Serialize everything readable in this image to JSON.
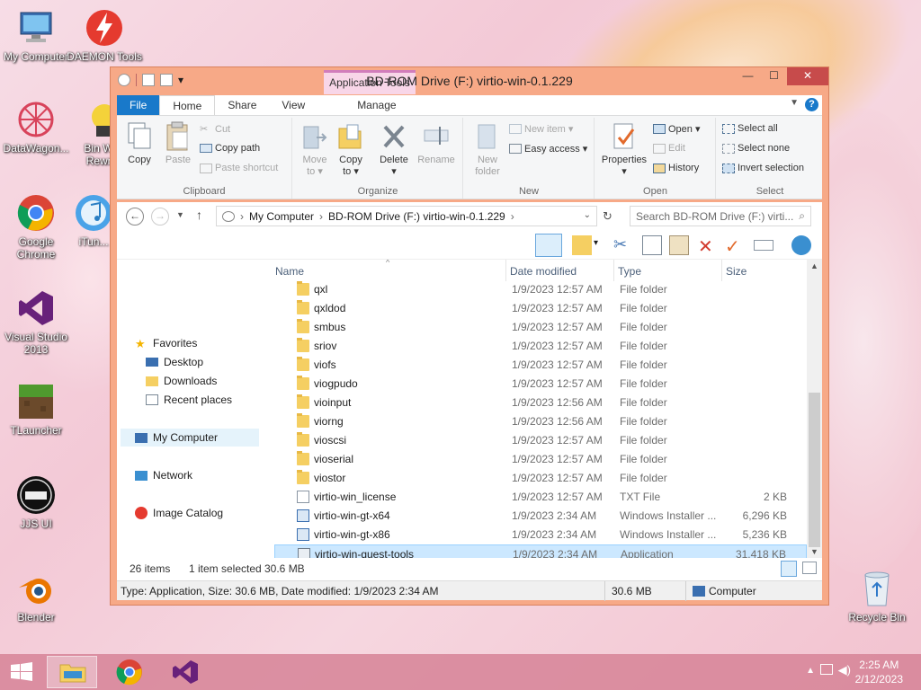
{
  "desktop": {
    "icons": [
      {
        "label": "My Computer"
      },
      {
        "label": "DAEMON Tools"
      },
      {
        "label": "DataWagon..."
      },
      {
        "label": "Bin Wea Rewri..."
      },
      {
        "label": "Google Chrome"
      },
      {
        "label": "iTun..."
      },
      {
        "label": "Visual Studio 2013"
      },
      {
        "label": "TLauncher"
      },
      {
        "label": "JJS UI"
      },
      {
        "label": "Blender"
      },
      {
        "label": "Recycle Bin"
      }
    ]
  },
  "window": {
    "title": "BD-ROM Drive (F:) virtio-win-0.1.229",
    "contextual_tab_group": "Application Tools",
    "controls": {
      "minimize": "—",
      "maximize": "☐",
      "close": "✕"
    }
  },
  "ribbon": {
    "tabs": [
      "File",
      "Home",
      "Share",
      "View",
      "Manage"
    ],
    "help": "?",
    "groups": {
      "clipboard": {
        "label": "Clipboard",
        "copy": "Copy",
        "paste": "Paste",
        "cut": "Cut",
        "copy_path": "Copy path",
        "paste_shortcut": "Paste shortcut"
      },
      "organize": {
        "label": "Organize",
        "move_to": "Move to ▾",
        "copy_to": "Copy to ▾",
        "delete": "Delete ▾",
        "rename": "Rename"
      },
      "new": {
        "label": "New",
        "new_folder": "New folder",
        "new_item": "New item ▾",
        "easy_access": "Easy access ▾"
      },
      "open": {
        "label": "Open",
        "properties": "Properties ▾",
        "open": "Open ▾",
        "edit": "Edit",
        "history": "History"
      },
      "select": {
        "label": "Select",
        "select_all": "Select all",
        "select_none": "Select none",
        "invert_selection": "Invert selection"
      }
    }
  },
  "address": {
    "crumbs": [
      "My Computer",
      "BD-ROM Drive (F:) virtio-win-0.1.229"
    ],
    "search_placeholder": "Search BD-ROM Drive (F:) virti..."
  },
  "nav": {
    "favorites": "Favorites",
    "desktop": "Desktop",
    "downloads": "Downloads",
    "recent": "Recent places",
    "my_computer": "My Computer",
    "network": "Network",
    "image_catalog": "Image Catalog"
  },
  "columns": {
    "name": "Name",
    "date": "Date modified",
    "type": "Type",
    "size": "Size"
  },
  "files": [
    {
      "name": "qxl",
      "date": "1/9/2023 12:57 AM",
      "type": "File folder",
      "size": "",
      "kind": "folder"
    },
    {
      "name": "qxldod",
      "date": "1/9/2023 12:57 AM",
      "type": "File folder",
      "size": "",
      "kind": "folder"
    },
    {
      "name": "smbus",
      "date": "1/9/2023 12:57 AM",
      "type": "File folder",
      "size": "",
      "kind": "folder"
    },
    {
      "name": "sriov",
      "date": "1/9/2023 12:57 AM",
      "type": "File folder",
      "size": "",
      "kind": "folder"
    },
    {
      "name": "viofs",
      "date": "1/9/2023 12:57 AM",
      "type": "File folder",
      "size": "",
      "kind": "folder"
    },
    {
      "name": "viogpudo",
      "date": "1/9/2023 12:57 AM",
      "type": "File folder",
      "size": "",
      "kind": "folder"
    },
    {
      "name": "vioinput",
      "date": "1/9/2023 12:56 AM",
      "type": "File folder",
      "size": "",
      "kind": "folder"
    },
    {
      "name": "viorng",
      "date": "1/9/2023 12:56 AM",
      "type": "File folder",
      "size": "",
      "kind": "folder"
    },
    {
      "name": "vioscsi",
      "date": "1/9/2023 12:57 AM",
      "type": "File folder",
      "size": "",
      "kind": "folder"
    },
    {
      "name": "vioserial",
      "date": "1/9/2023 12:57 AM",
      "type": "File folder",
      "size": "",
      "kind": "folder"
    },
    {
      "name": "viostor",
      "date": "1/9/2023 12:57 AM",
      "type": "File folder",
      "size": "",
      "kind": "folder"
    },
    {
      "name": "virtio-win_license",
      "date": "1/9/2023 12:57 AM",
      "type": "TXT File",
      "size": "2 KB",
      "kind": "txt"
    },
    {
      "name": "virtio-win-gt-x64",
      "date": "1/9/2023 2:34 AM",
      "type": "Windows Installer ...",
      "size": "6,296 KB",
      "kind": "msi"
    },
    {
      "name": "virtio-win-gt-x86",
      "date": "1/9/2023 2:34 AM",
      "type": "Windows Installer ...",
      "size": "5,236 KB",
      "kind": "msi"
    },
    {
      "name": "virtio-win-guest-tools",
      "date": "1/9/2023 2:34 AM",
      "type": "Application",
      "size": "31,418 KB",
      "kind": "exe",
      "selected": true
    }
  ],
  "status": {
    "count": "26 items",
    "selected": "1 item selected",
    "selected_size": "30.6 MB"
  },
  "details": {
    "text": "Type: Application, Size: 30.6 MB, Date modified: 1/9/2023 2:34 AM",
    "size": "30.6 MB",
    "location": "Computer"
  },
  "taskbar": {
    "time": "2:25 AM",
    "date": "2/12/2023"
  }
}
